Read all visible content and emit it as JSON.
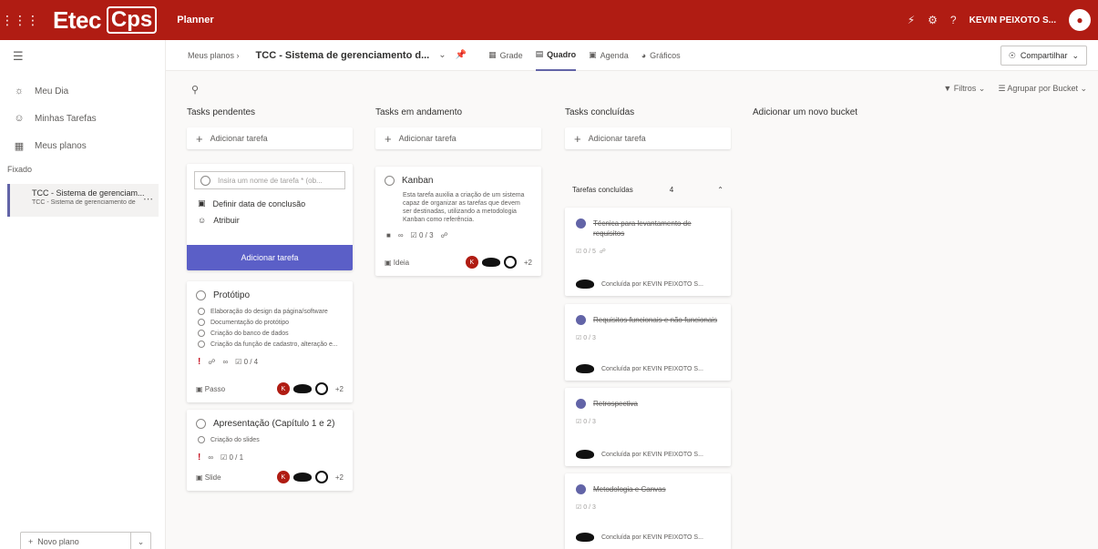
{
  "topbar": {
    "logo_main": "Etec",
    "logo_sub": "Cps",
    "app_name": "Planner",
    "user_name": "KEVIN PEIXOTO S..."
  },
  "leftnav": {
    "items": [
      {
        "icon": "sun-icon",
        "label": "Meu Dia"
      },
      {
        "icon": "person-icon",
        "label": "Minhas Tarefas"
      },
      {
        "icon": "grid-icon",
        "label": "Meus planos"
      }
    ],
    "section_label": "Fixado",
    "pinned_plan": {
      "title": "TCC - Sistema de gerenciam...",
      "subtitle": "TCC - Sistema de gerenciamento de"
    },
    "new_plan": "Novo plano"
  },
  "header": {
    "breadcrumb": "Meus planos",
    "plan_title": "TCC - Sistema de gerenciamento d...",
    "tabs": [
      {
        "label": "Grade",
        "active": false
      },
      {
        "label": "Quadro",
        "active": true
      },
      {
        "label": "Agenda",
        "active": false
      },
      {
        "label": "Gráficos",
        "active": false
      }
    ],
    "share": "Compartilhar"
  },
  "toolbar": {
    "filters": "Filtros",
    "group_by": "Agrupar por Bucket"
  },
  "buckets": [
    {
      "title": "Tasks pendentes",
      "add_label": "Adicionar tarefa"
    },
    {
      "title": "Tasks em andamento",
      "add_label": "Adicionar tarefa"
    },
    {
      "title": "Tasks concluídas",
      "add_label": "Adicionar tarefa"
    },
    {
      "title": "Adicionar um novo bucket"
    }
  ],
  "new_task_form": {
    "placeholder": "Insira um nome de tarefa * (ob...",
    "due_date": "Definir data de conclusão",
    "assign": "Atribuir",
    "submit": "Adicionar tarefa"
  },
  "pending_tasks": [
    {
      "title": "Protótipo",
      "checklist": [
        "Elaboração do design da página/software",
        "Documentação do protótipo",
        "Criação do banco de dados",
        "Criação da função de cadastro, alteração e..."
      ],
      "progress": "0 / 4",
      "bucket_label": "Passo",
      "extra_assignees": "+2"
    },
    {
      "title": "Apresentação (Capítulo 1 e 2)",
      "checklist": [
        "Criação do slides"
      ],
      "progress": "0 / 1",
      "bucket_label": "Slide",
      "extra_assignees": "+2"
    }
  ],
  "inprogress_task": {
    "title": "Kanban",
    "description": "Esta tarefa auxilia a criação de um sistema capaz de organizar as tarefas que devem ser destinadas, utilizando a metodologia Kanban como referência.",
    "progress": "0 / 3",
    "bucket_label": "Ideia",
    "extra_assignees": "+2"
  },
  "completed": {
    "header": "Tarefas concluídas",
    "count": "4",
    "items": [
      {
        "title": "Técnica para levantamento de requisitos",
        "progress": "0 / 5",
        "done_by": "Concluída por KEVIN PEIXOTO S..."
      },
      {
        "title": "Requisitos funcionais e não funcionais",
        "progress": "0 / 3",
        "done_by": "Concluída por KEVIN PEIXOTO S..."
      },
      {
        "title": "Retrospectiva",
        "progress": "0 / 3",
        "done_by": "Concluída por KEVIN PEIXOTO S..."
      },
      {
        "title": "Metodologia e Canvas",
        "progress": "0 / 3",
        "done_by": "Concluída por KEVIN PEIXOTO S..."
      }
    ]
  },
  "colors": {
    "brand": "#b01c13",
    "accent": "#6264a7",
    "button": "#5b5fc7"
  }
}
